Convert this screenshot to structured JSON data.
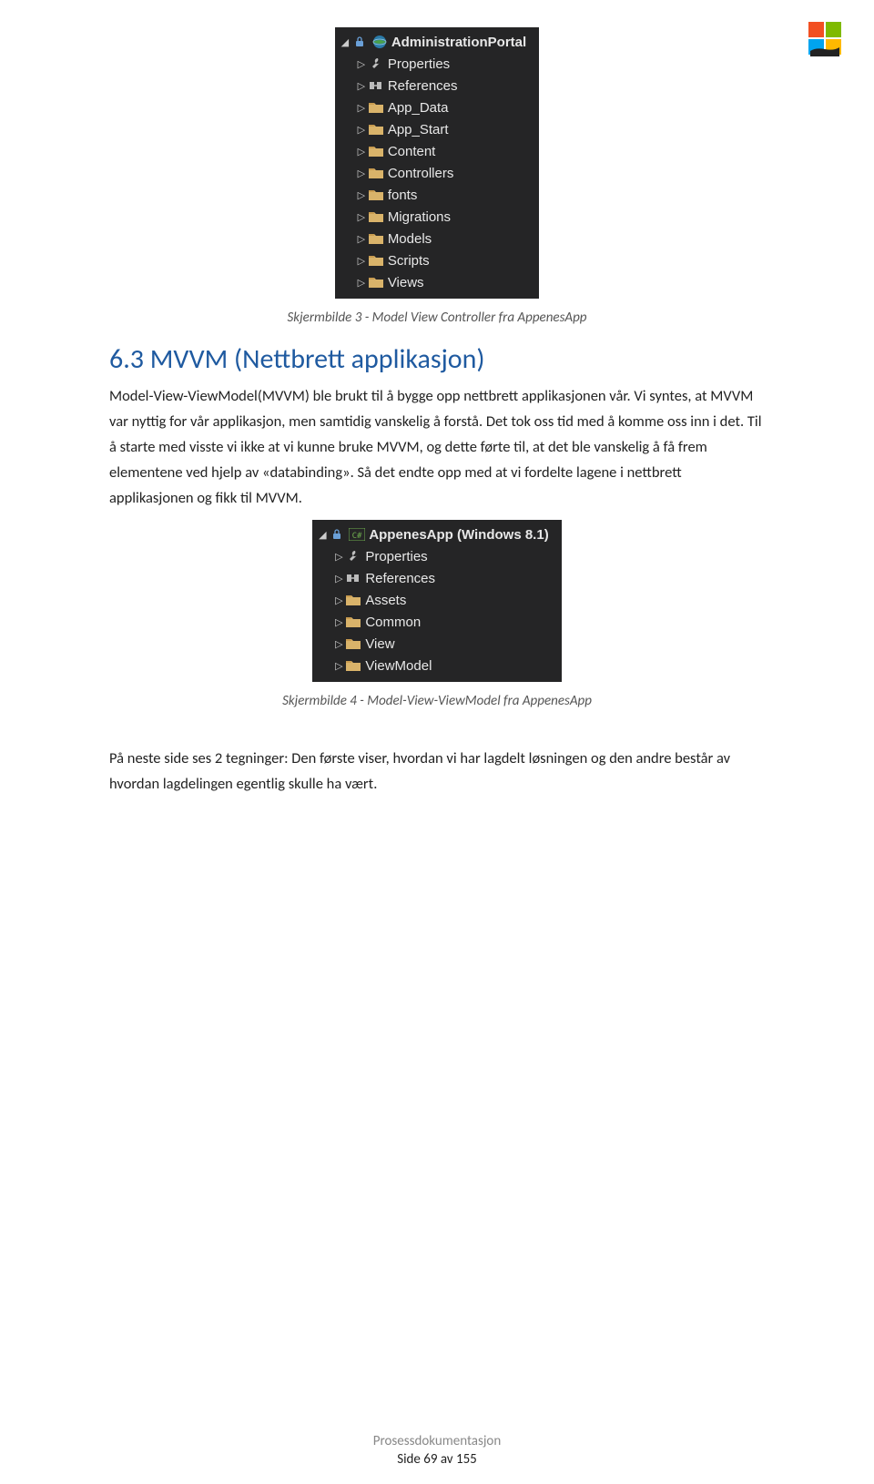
{
  "logo_name": "windows-store-logo",
  "tree1": {
    "root": "AdministrationPortal",
    "items": [
      {
        "icon": "wrench",
        "label": "Properties"
      },
      {
        "icon": "ref",
        "label": "References"
      },
      {
        "icon": "folder",
        "label": "App_Data"
      },
      {
        "icon": "folder",
        "label": "App_Start"
      },
      {
        "icon": "folder",
        "label": "Content"
      },
      {
        "icon": "folder",
        "label": "Controllers"
      },
      {
        "icon": "folder",
        "label": "fonts"
      },
      {
        "icon": "folder",
        "label": "Migrations"
      },
      {
        "icon": "folder",
        "label": "Models"
      },
      {
        "icon": "folder",
        "label": "Scripts"
      },
      {
        "icon": "folder",
        "label": "Views"
      }
    ]
  },
  "caption1": "Skjermbilde 3 - Model View Controller fra AppenesApp",
  "heading": "6.3  MVVM (Nettbrett applikasjon)",
  "para1": "Model-View-ViewModel(MVVM) ble brukt til å bygge opp nettbrett applikasjonen vår. Vi syntes, at MVVM var nyttig for vår applikasjon, men samtidig vanskelig å forstå. Det tok oss tid med å komme oss inn i det. Til å starte med visste vi ikke at vi kunne bruke MVVM, og dette førte til, at det ble vanskelig å få frem elementene ved hjelp av «databinding». Så det endte opp med at vi fordelte lagene i nettbrett applikasjonen og fikk til MVVM.",
  "tree2": {
    "root": "AppenesApp (Windows 8.1)",
    "items": [
      {
        "icon": "wrench",
        "label": "Properties"
      },
      {
        "icon": "ref",
        "label": "References"
      },
      {
        "icon": "folder",
        "label": "Assets"
      },
      {
        "icon": "folder",
        "label": "Common"
      },
      {
        "icon": "folder",
        "label": "View"
      },
      {
        "icon": "folder",
        "label": "ViewModel"
      }
    ]
  },
  "caption2": "Skjermbilde 4 - Model-View-ViewModel fra AppenesApp",
  "para2": "På neste side ses 2 tegninger: Den første viser, hvordan vi har lagdelt løsningen og den andre består av hvordan lagdelingen egentlig skulle ha vært.",
  "footer": {
    "title": "Prosessdokumentasjon",
    "page": "Side 69 av 155"
  }
}
